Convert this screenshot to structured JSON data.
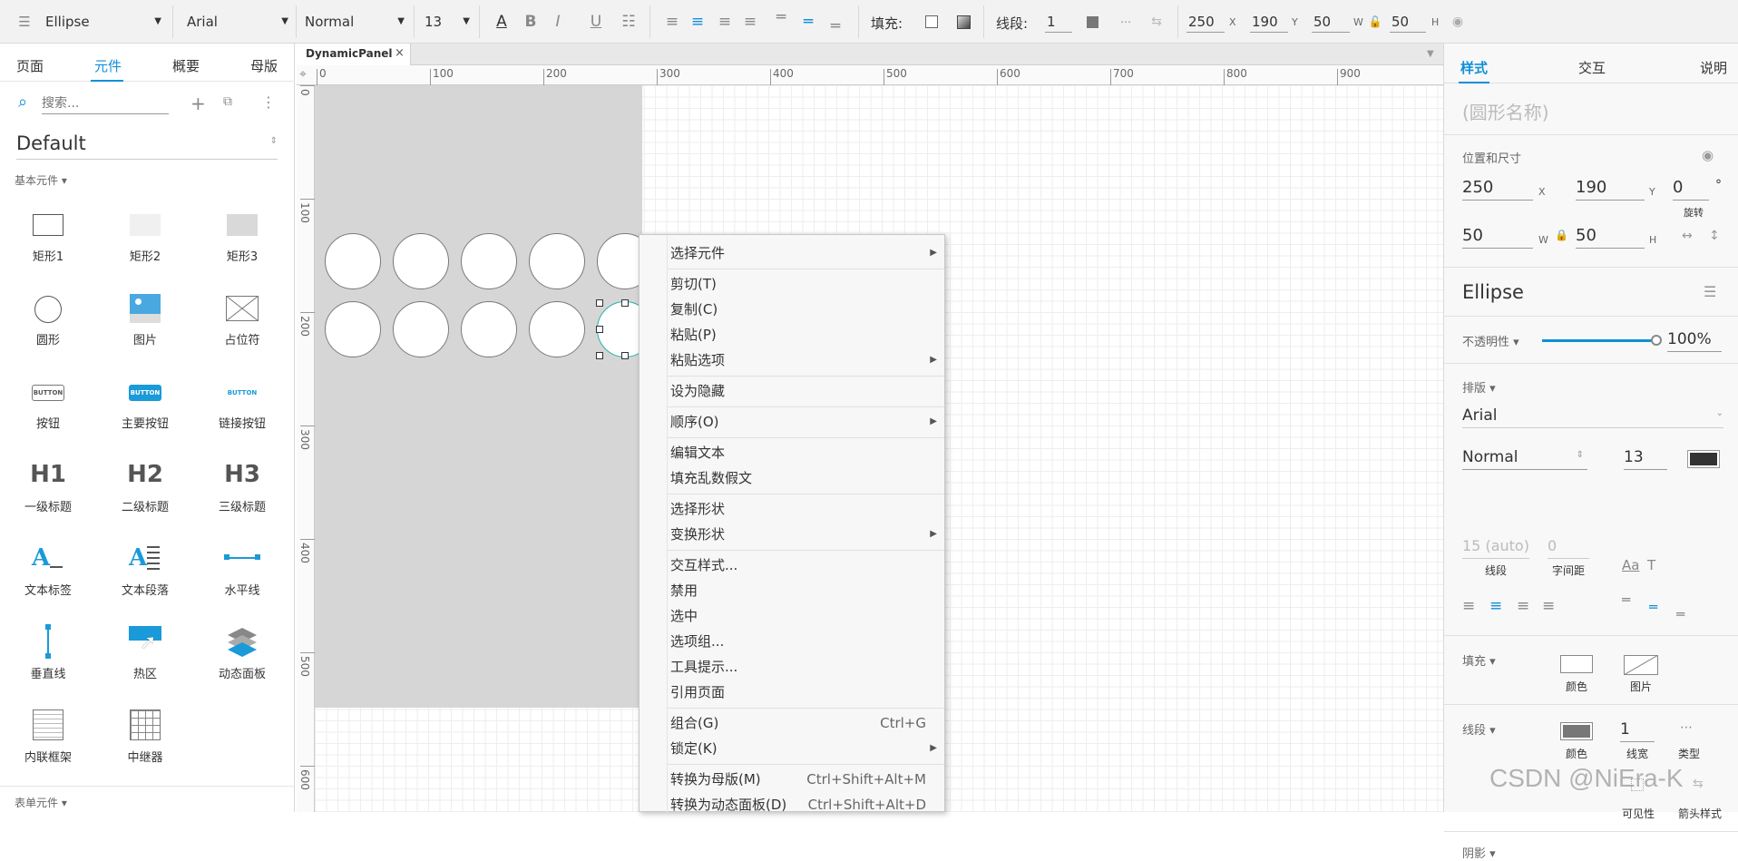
{
  "toolbar": {
    "shape_name": "Ellipse",
    "font_family": "Arial",
    "font_style": "Normal",
    "font_size": "13",
    "fill_label": "填充:",
    "stroke_label": "线段:",
    "stroke_width": "1",
    "x": "250",
    "x_unit": "X",
    "y": "190",
    "y_unit": "Y",
    "w": "50",
    "w_unit": "W",
    "h": "50",
    "h_unit": "H"
  },
  "left": {
    "tabs": [
      "页面",
      "元件",
      "概要",
      "母版"
    ],
    "active_tab": "元件",
    "search_placeholder": "搜索...",
    "library": "Default",
    "section_basic": "基本元件 ▾",
    "section_form": "表单元件 ▾",
    "items": [
      "矩形1",
      "矩形2",
      "矩形3",
      "圆形",
      "图片",
      "占位符",
      "按钮",
      "主要按钮",
      "链接按钮",
      "一级标题",
      "二级标题",
      "三级标题",
      "文本标签",
      "文本段落",
      "水平线",
      "垂直线",
      "热区",
      "动态面板",
      "内联框架",
      "中继器"
    ],
    "icon_text": {
      "button": "BUTTON",
      "h1": "H1",
      "h2": "H2",
      "h3": "H3"
    }
  },
  "canvas": {
    "tab_label": "DynamicPanel",
    "ruler_h": [
      "0",
      "100",
      "200",
      "300",
      "400",
      "500",
      "600",
      "700",
      "800",
      "900"
    ],
    "ruler_v": [
      "0",
      "100",
      "200",
      "300",
      "400",
      "500",
      "600"
    ]
  },
  "menu": {
    "items": [
      {
        "label": "选择元件",
        "submenu": true
      },
      {
        "label": "剪切(T)"
      },
      {
        "label": "复制(C)"
      },
      {
        "label": "粘贴(P)"
      },
      {
        "label": "粘贴选项",
        "submenu": true
      },
      {
        "label": "设为隐藏"
      },
      {
        "label": "顺序(O)",
        "submenu": true
      },
      {
        "label": "编辑文本"
      },
      {
        "label": "填充乱数假文"
      },
      {
        "label": "选择形状"
      },
      {
        "label": "变换形状",
        "submenu": true
      },
      {
        "label": "交互样式..."
      },
      {
        "label": "禁用"
      },
      {
        "label": "选中"
      },
      {
        "label": "选项组..."
      },
      {
        "label": "工具提示..."
      },
      {
        "label": "引用页面"
      },
      {
        "label": "组合(G)",
        "shortcut": "Ctrl+G"
      },
      {
        "label": "锁定(K)",
        "submenu": true
      },
      {
        "label": "转换为母版(M)",
        "shortcut": "Ctrl+Shift+Alt+M"
      },
      {
        "label": "转换为动态面板(D)",
        "shortcut": "Ctrl+Shift+Alt+D"
      }
    ]
  },
  "right": {
    "tabs": [
      "样式",
      "交互",
      "说明"
    ],
    "active_tab": "样式",
    "name_placeholder": "(圆形名称)",
    "pos_size_label": "位置和尺寸",
    "x": "250",
    "x_unit": "X",
    "y": "190",
    "y_unit": "Y",
    "rotation": "0",
    "rotation_unit": "°",
    "rotation_label": "旋转",
    "w": "50",
    "w_unit": "W",
    "h": "50",
    "h_unit": "H",
    "style_name": "Ellipse",
    "opacity_label": "不透明性 ▾",
    "opacity": "100%",
    "opacity_fraction": 1.0,
    "typography_label": "排版 ▾",
    "font_family": "Arial",
    "font_style": "Normal",
    "font_size": "13",
    "line_spacing": "15 (auto)",
    "line_spacing_label": "线段",
    "char_spacing": "0",
    "char_spacing_label": "字间距",
    "fill_label": "填充 ▾",
    "fill_color_label": "颜色",
    "fill_image_label": "图片",
    "stroke_label": "线段 ▾",
    "stroke_color_label": "颜色",
    "stroke_width": "1",
    "stroke_width_label": "线宽",
    "stroke_type_label": "类型",
    "visible_label": "可见性",
    "arrow_label": "箭头样式",
    "shadow_label": "阴影 ▾"
  },
  "watermark": "CSDN @NiEra-K",
  "colors": {
    "accent": "#0f8fd8",
    "panel_gray": "#d6d6d6",
    "selection": "#1fb0a8"
  }
}
